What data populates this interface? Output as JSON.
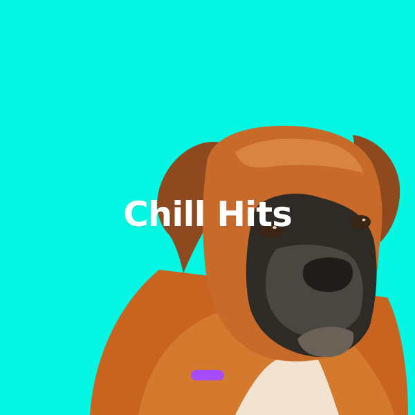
{
  "playlist": {
    "title": "Chill Hits",
    "image_subject": "boxer-dog"
  },
  "colors": {
    "background": "#05F7E4",
    "accent": "#A54CFF",
    "title": "#FFFFFF"
  }
}
